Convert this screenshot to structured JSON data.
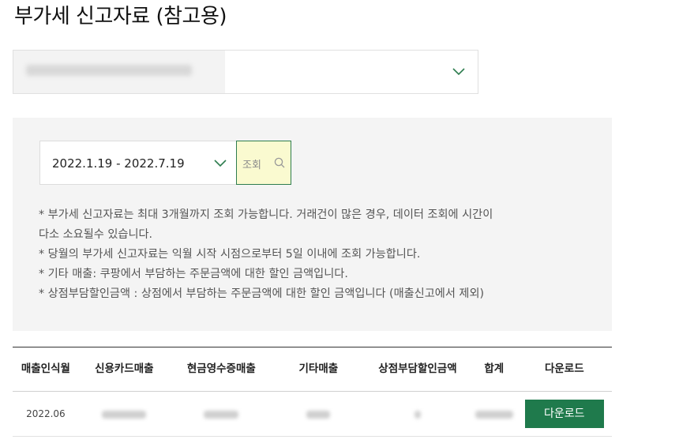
{
  "page": {
    "title": "부가세 신고자료 (참고용)"
  },
  "store_select": {
    "value": "대리점 · 0000000000",
    "icon": "chevron-down-icon"
  },
  "filter": {
    "date_range": "2022.1.19 - 2022.7.19",
    "search_label": "조회",
    "notes": [
      "* 부가세 신고자료는 최대 3개월까지 조회 가능합니다. 거래건이 많은 경우, 데이터 조회에 시간이",
      "다소 소요될수 있습니다.",
      "* 당월의 부가세 신고자료는 익월 시작 시점으로부터 5일 이내에 조회 가능합니다.",
      "* 기타 매출: 쿠팡에서 부담하는 주문금액에 대한 할인 금액입니다.",
      "* 상점부담할인금액 : 상점에서 부담하는 주문금액에 대한 할인 금액입니다 (매출신고에서 제외)"
    ]
  },
  "table": {
    "headers": [
      "매출인식월",
      "신용카드매출",
      "현금영수증매출",
      "기타매출",
      "상점부담할인금액",
      "합계",
      "다운로드"
    ],
    "rows": [
      {
        "month": "2022.06",
        "download_label": "다운로드"
      }
    ]
  },
  "colors": {
    "accent": "#1f7a4c",
    "panel": "#f4f4f4",
    "highlight": "#fafad0"
  }
}
